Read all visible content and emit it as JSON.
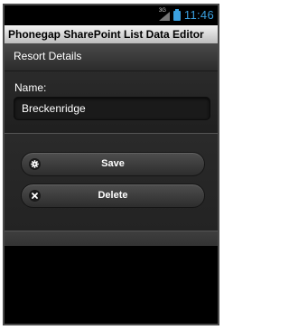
{
  "status": {
    "network": "3G",
    "time": "11:46",
    "accent_color": "#3aa0e0"
  },
  "app": {
    "title": "Phonegap SharePoint List Data Editor"
  },
  "page": {
    "header": "Resort Details"
  },
  "form": {
    "name_label": "Name:",
    "name_value": "Breckenridge"
  },
  "actions": {
    "save_label": "Save",
    "save_icon": "gear-icon",
    "delete_label": "Delete",
    "delete_icon": "close-icon"
  }
}
